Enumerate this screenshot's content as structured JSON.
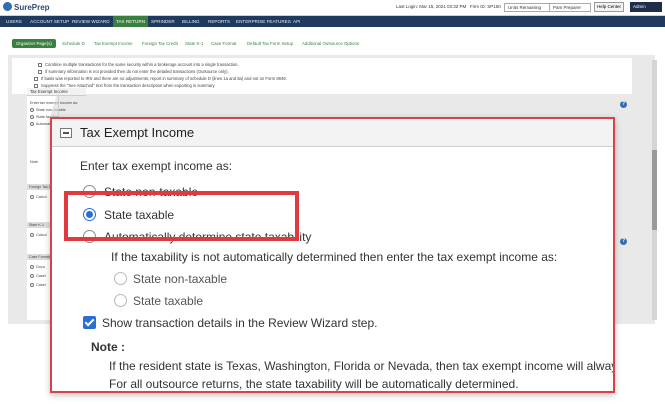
{
  "app": {
    "logo_text": "SurePrep",
    "last_login": "Last Login: Mar 15, 2021 03:32 PM",
    "firm_id": "Firm ID: SP150",
    "units_dropdown": "Units Remaining",
    "user_dropdown": "Pam Preparer",
    "help_center": "Help Center",
    "admin_menu": "Admin"
  },
  "nav": {
    "items": [
      "USERS",
      "ACCOUNT SETUP",
      "REVIEW WIZARD",
      "TAX RETURN",
      "SPRINDER",
      "BILLING",
      "REPORTS",
      "ENTERPRISE FEATURES",
      "API"
    ],
    "active": "TAX RETURN"
  },
  "subtabs": {
    "items": [
      "Organizer Page(s)",
      "Schedule D",
      "Tax Exempt Income",
      "Foreign Tax Credit",
      "State K-1",
      "Case Format",
      "Default Tax Form Setup",
      "Additional Outsource Options"
    ],
    "active": "Organizer Page(s)"
  },
  "background": {
    "lines": [
      "Combine multiple transactions for the same security within a brokerage account into a single transaction.",
      "If summary information is not provided then do not enter the detailed transactions (Outsource only).",
      "If basis was reported to IRS and there are no adjustments, report in summary of schedule D (lines 1a and 8a) and not on Form 8949.",
      "Suppress the \"See Attached\" text from the transaction description when exporting in summary"
    ],
    "panel_title": "Tax Exempt Income",
    "panel_intro": "Enter tax exempt income as:",
    "panel_options": [
      "State non-taxable",
      "State taxable",
      "Automatically determine"
    ],
    "panel_note": "Note",
    "section_labels": [
      "Foreign Tax Credit",
      "State K-1",
      "Case Format"
    ],
    "section_options": [
      "Calcul",
      "Calcul",
      "Docu",
      "Casel",
      "Casel"
    ]
  },
  "dialog": {
    "title": "Tax Exempt Income",
    "intro": "Enter tax exempt income as:",
    "options": [
      {
        "label": "State non-taxable",
        "selected": false
      },
      {
        "label": "State taxable",
        "selected": true
      },
      {
        "label": "Automatically determine state taxability",
        "selected": false
      }
    ],
    "sub_intro": "If the taxability is not automatically determined then enter the tax exempt income as:",
    "sub_options": [
      {
        "label": "State non-taxable",
        "selected": false
      },
      {
        "label": "State taxable",
        "selected": false
      }
    ],
    "checkbox_label": "Show transaction details in the Review Wizard step.",
    "checkbox_checked": true,
    "note_label": "Note :",
    "note_lines": [
      "If the resident state is Texas, Washington, Florida or Nevada, then tax exempt income will always be state non-taxable.",
      "For all outsource returns, the state taxability will be automatically determined."
    ]
  },
  "colors": {
    "nav_bg": "#1f3a5f",
    "accent_green": "#3a7f3e",
    "highlight_red": "#e03a3f",
    "radio_blue": "#2a6fd6"
  }
}
